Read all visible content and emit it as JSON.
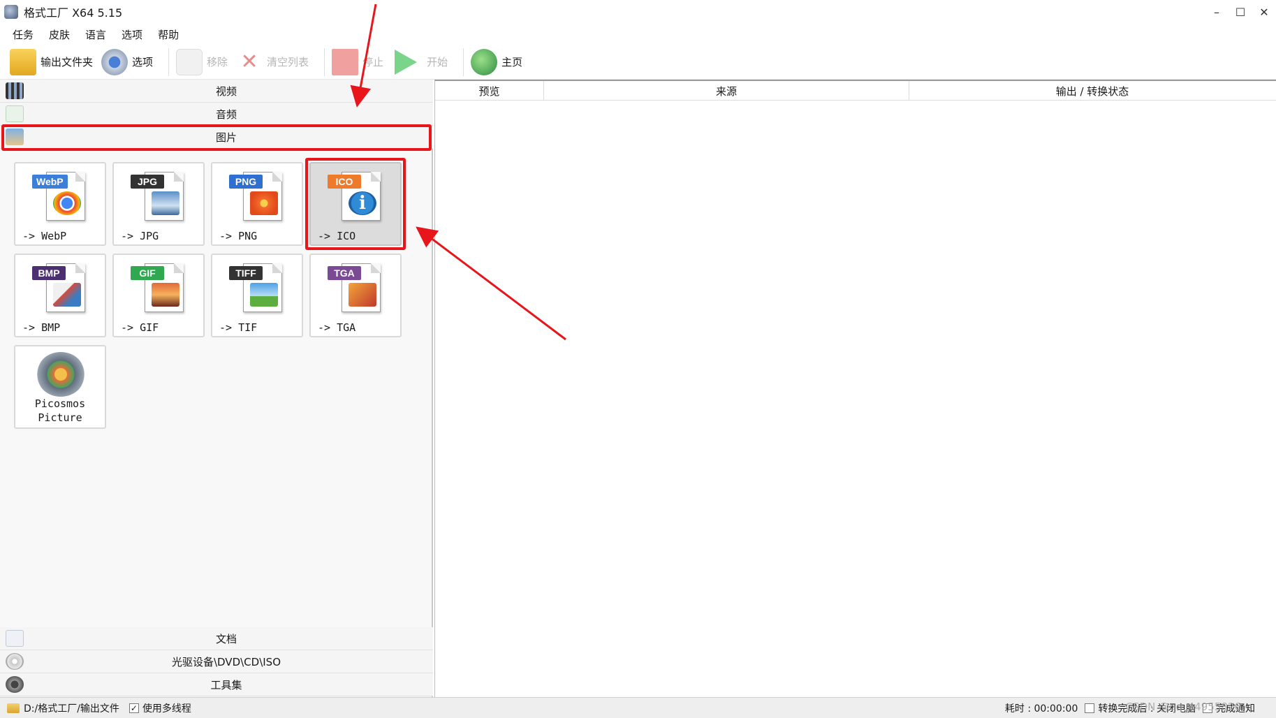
{
  "window": {
    "title": "格式工厂 X64 5.15",
    "controls": {
      "minimize": "–",
      "maximize": "☐",
      "close": "✕"
    }
  },
  "menu": [
    "任务",
    "皮肤",
    "语言",
    "选项",
    "帮助"
  ],
  "toolbar": {
    "output_folder": "输出文件夹",
    "options": "选项",
    "remove": "移除",
    "clear_list": "清空列表",
    "stop": "停止",
    "start": "开始",
    "home": "主页"
  },
  "categories": {
    "video": "视频",
    "audio": "音频",
    "image": "图片",
    "document": "文档",
    "disc": "光驱设备\\DVD\\CD\\ISO",
    "tools": "工具集"
  },
  "image_formats": [
    {
      "badge": "WebP",
      "caption": "-> WebP",
      "badge_color": "#3b7fd9"
    },
    {
      "badge": "JPG",
      "caption": "-> JPG",
      "badge_color": "#333333"
    },
    {
      "badge": "PNG",
      "caption": "-> PNG",
      "badge_color": "#2f6fd0"
    },
    {
      "badge": "ICO",
      "caption": "-> ICO",
      "badge_color": "#ee7a2b"
    },
    {
      "badge": "BMP",
      "caption": "-> BMP",
      "badge_color": "#4b2f70"
    },
    {
      "badge": "GIF",
      "caption": "-> GIF",
      "badge_color": "#2fa84f"
    },
    {
      "badge": "TIFF",
      "caption": "-> TIF",
      "badge_color": "#333333"
    },
    {
      "badge": "TGA",
      "caption": "-> TGA",
      "badge_color": "#7a4a94"
    }
  ],
  "picosmos": {
    "line1": "Picosmos",
    "line2": "Picture"
  },
  "task_table": {
    "columns": [
      "预览",
      "来源",
      "输出 / 转换状态"
    ]
  },
  "statusbar": {
    "output_path": "D:/格式工厂/输出文件",
    "multithread_label": "使用多线程",
    "multithread_checked": "✓",
    "elapsed": "耗时 : 00:00:00",
    "after_convert": "转换完成后 : 关闭电脑",
    "notify": "完成通知"
  },
  "watermark": "CSDN @qq_44955826",
  "colors": {
    "highlight": "#e8161b"
  }
}
